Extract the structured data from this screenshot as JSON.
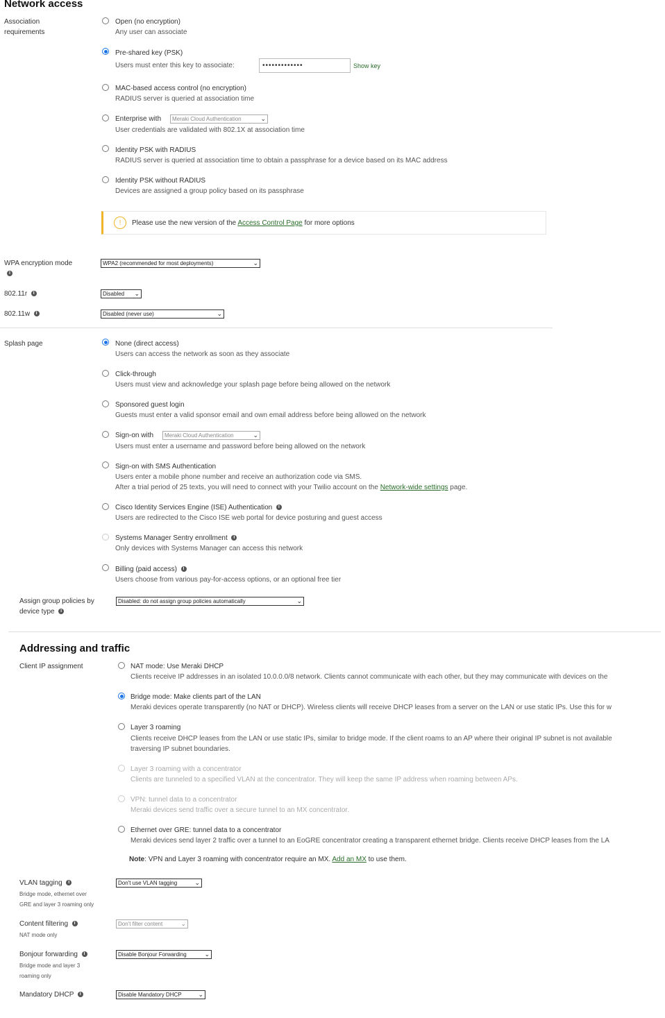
{
  "network_access": {
    "title": "Network access",
    "association": {
      "label": "Association requirements",
      "options": [
        {
          "label": "Open (no encryption)",
          "desc": "Any user can associate"
        },
        {
          "label": "Pre-shared key (PSK)",
          "desc": "Users must enter this key to associate:"
        },
        {
          "label": "MAC-based access control (no encryption)",
          "desc": "RADIUS server is queried at association time"
        },
        {
          "label": "Enterprise with",
          "desc": "User credentials are validated with 802.1X at association time"
        },
        {
          "label": "Identity PSK with RADIUS",
          "desc": "RADIUS server is queried at association time to obtain a passphrase for a device based on its MAC address"
        },
        {
          "label": "Identity PSK without RADIUS",
          "desc": "Devices are assigned a group policy based on its passphrase"
        }
      ],
      "selected": "Pre-shared key (PSK)",
      "psk_value": "•••••••••••••",
      "show_key": "Show key",
      "enterprise_select": "Meraki Cloud Authentication",
      "alert_prefix": "Please use the new version of the",
      "alert_link": "Access Control Page",
      "alert_suffix": "for more options"
    },
    "wpa": {
      "label": "WPA encryption mode",
      "value": "WPA2 (recommended for most deployments)"
    },
    "r80211r": {
      "label": "802.11r",
      "value": "Disabled"
    },
    "r80211w": {
      "label": "802.11w",
      "value": "Disabled (never use)"
    }
  },
  "splash": {
    "label": "Splash page",
    "options": [
      {
        "label": "None (direct access)",
        "desc": "Users can access the network as soon as they associate"
      },
      {
        "label": "Click-through",
        "desc": "Users must view and acknowledge your splash page before being allowed on the network"
      },
      {
        "label": "Sponsored guest login",
        "desc": "Guests must enter a valid sponsor email and own email address before being allowed on the network"
      },
      {
        "label": "Sign-on with",
        "desc": "Users must enter a username and password before being allowed on the network"
      },
      {
        "label": "Sign-on with SMS Authentication",
        "desc": "Users enter a mobile phone number and receive an authorization code via SMS.",
        "desc2_prefix": "After a trial period of 25 texts, you will need to connect with your Twilio account on the",
        "desc2_link": "Network-wide settings",
        "desc2_suffix": "page."
      },
      {
        "label": "Cisco Identity Services Engine (ISE) Authentication",
        "desc": "Users are redirected to the Cisco ISE web portal for device posturing and guest access"
      },
      {
        "label": "Systems Manager Sentry enrollment",
        "desc": "Only devices with Systems Manager can access this network"
      },
      {
        "label": "Billing (paid access)",
        "desc": "Users choose from various pay-for-access options, or an optional free tier"
      }
    ],
    "selected": "None (direct access)",
    "signon_select": "Meraki Cloud Authentication",
    "group_policy_label": "Assign group policies by device type",
    "group_policy_value": "Disabled: do not assign group policies automatically"
  },
  "addressing": {
    "title": "Addressing and traffic",
    "client_ip_label": "Client IP assignment",
    "options": [
      {
        "label": "NAT mode: Use Meraki DHCP",
        "desc": "Clients receive IP addresses in an isolated 10.0.0.0/8 network. Clients cannot communicate with each other, but they may communicate with devices on the"
      },
      {
        "label": "Bridge mode: Make clients part of the LAN",
        "desc": "Meraki devices operate transparently (no NAT or DHCP). Wireless clients will receive DHCP leases from a server on the LAN or use static IPs. Use this for w"
      },
      {
        "label": "Layer 3 roaming",
        "desc": "Clients receive DHCP leases from the LAN or use static IPs, similar to bridge mode. If the client roams to an AP where their original IP subnet is not available",
        "desc2": "traversing IP subnet boundaries."
      },
      {
        "label": "Layer 3 roaming with a concentrator",
        "desc": "Clients are tunneled to a specified VLAN at the concentrator. They will keep the same IP address when roaming between APs."
      },
      {
        "label": "VPN: tunnel data to a concentrator",
        "desc": "Meraki devices send traffic over a secure tunnel to an MX concentrator."
      },
      {
        "label": "Ethernet over GRE: tunnel data to a concentrator",
        "desc": "Meraki devices send layer 2 traffic over a tunnel to an EoGRE concentrator creating a transparent ethernet bridge. Clients receive DHCP leases from the LA"
      }
    ],
    "selected": "Bridge mode: Make clients part of the LAN",
    "note_bold": "Note",
    "note_text": ": VPN and Layer 3 roaming with concentrator require an MX.",
    "note_link": "Add an MX",
    "note_suffix": "to use them.",
    "vlan": {
      "label": "VLAN tagging",
      "sub1": "Bridge mode, ethernet over",
      "sub2": "GRE and layer 3 roaming only",
      "value": "Don't use VLAN tagging"
    },
    "content": {
      "label": "Content filtering",
      "sub1": "NAT mode only",
      "value": "Don't filter content"
    },
    "bonjour": {
      "label": "Bonjour forwarding",
      "sub1": "Bridge mode and layer 3",
      "sub2": "roaming only",
      "value": "Disable Bonjour Forwarding"
    },
    "dhcp": {
      "label": "Mandatory DHCP",
      "value": "Disable Mandatory DHCP"
    }
  }
}
